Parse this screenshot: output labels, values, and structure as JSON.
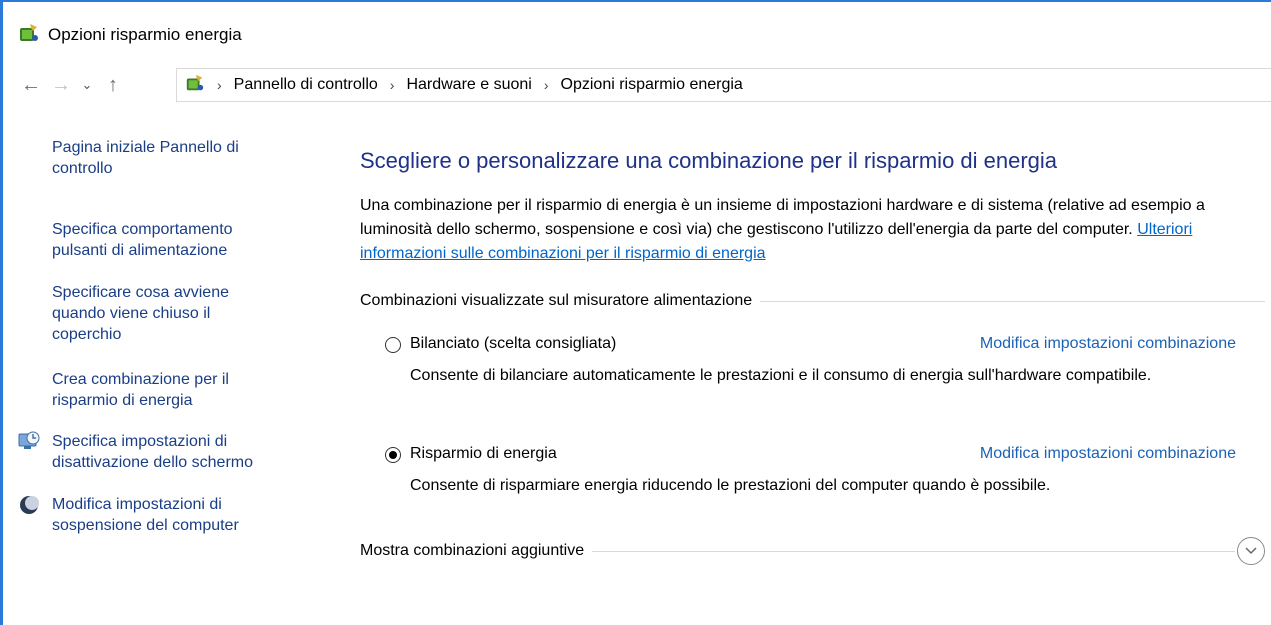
{
  "window": {
    "title": "Opzioni risparmio energia"
  },
  "nav": {
    "back": "←",
    "forward": "→",
    "recent": "⌄",
    "up": "↑",
    "breadcrumbs": [
      "Pannello di controllo",
      "Hardware e suoni",
      "Opzioni risparmio energia"
    ],
    "separator": "›"
  },
  "sidebar": {
    "items": [
      {
        "label": "Pagina iniziale Pannello di controllo",
        "icon": ""
      },
      {
        "label": "Specifica comportamento pulsanti di alimentazione",
        "icon": ""
      },
      {
        "label": "Specificare cosa avviene quando viene chiuso il coperchio",
        "icon": ""
      },
      {
        "label": "Crea combinazione per il risparmio di energia",
        "icon": ""
      },
      {
        "label": "Specifica impostazioni di disattivazione dello schermo",
        "icon": "monitor-clock-icon"
      },
      {
        "label": "Modifica impostazioni di sospensione del computer",
        "icon": "moon-icon"
      }
    ]
  },
  "main": {
    "heading": "Scegliere o personalizzare una combinazione per il risparmio di energia",
    "description": "Una combinazione per il risparmio di energia è un insieme di impostazioni hardware e di sistema (relative ad esempio a luminosità dello schermo, sospensione e così via) che gestiscono l'utilizzo dell'energia da parte del computer.",
    "more_info_link": "Ulteriori informazioni sulle combinazioni per il risparmio di energia",
    "group_label": "Combinazioni visualizzate sul misuratore alimentazione",
    "plans": [
      {
        "name": "Bilanciato (scelta consigliata)",
        "selected": false,
        "edit_link": "Modifica impostazioni combinazione",
        "description": "Consente di bilanciare automaticamente le prestazioni e il consumo di energia sull'hardware compatibile."
      },
      {
        "name": "Risparmio di energia",
        "selected": true,
        "edit_link": "Modifica impostazioni combinazione",
        "description": "Consente di risparmiare energia riducendo le prestazioni del computer quando è possibile."
      }
    ],
    "show_more": "Mostra combinazioni aggiuntive",
    "expand_icon": "chevron-down-circle-icon"
  },
  "colors": {
    "heading": "#1e3287",
    "link": "#1a62b8",
    "sidebar_link": "#1a3e86",
    "window_border": "#2b79d8"
  }
}
